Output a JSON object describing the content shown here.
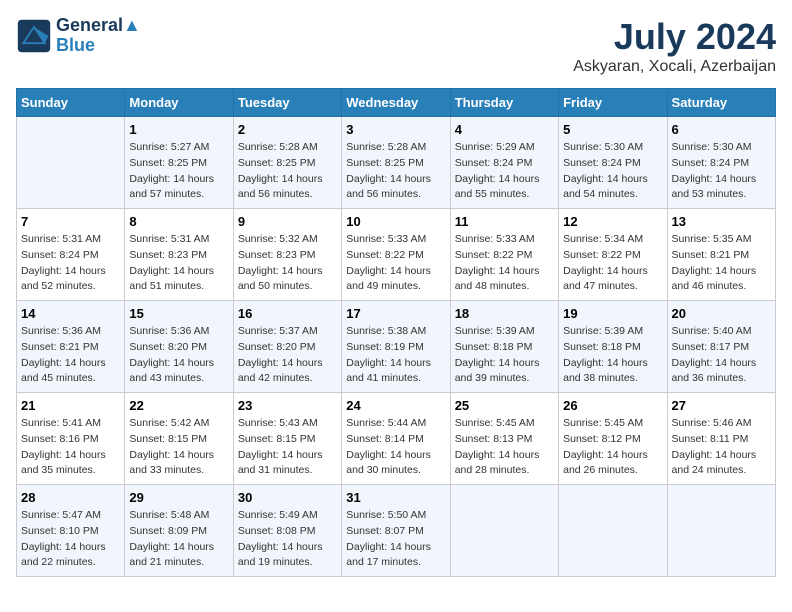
{
  "header": {
    "logo_line1": "General",
    "logo_line2": "Blue",
    "title": "July 2024",
    "subtitle": "Askyaran, Xocali, Azerbaijan"
  },
  "columns": [
    "Sunday",
    "Monday",
    "Tuesday",
    "Wednesday",
    "Thursday",
    "Friday",
    "Saturday"
  ],
  "weeks": [
    [
      {
        "day": "",
        "info": ""
      },
      {
        "day": "1",
        "info": "Sunrise: 5:27 AM\nSunset: 8:25 PM\nDaylight: 14 hours\nand 57 minutes."
      },
      {
        "day": "2",
        "info": "Sunrise: 5:28 AM\nSunset: 8:25 PM\nDaylight: 14 hours\nand 56 minutes."
      },
      {
        "day": "3",
        "info": "Sunrise: 5:28 AM\nSunset: 8:25 PM\nDaylight: 14 hours\nand 56 minutes."
      },
      {
        "day": "4",
        "info": "Sunrise: 5:29 AM\nSunset: 8:24 PM\nDaylight: 14 hours\nand 55 minutes."
      },
      {
        "day": "5",
        "info": "Sunrise: 5:30 AM\nSunset: 8:24 PM\nDaylight: 14 hours\nand 54 minutes."
      },
      {
        "day": "6",
        "info": "Sunrise: 5:30 AM\nSunset: 8:24 PM\nDaylight: 14 hours\nand 53 minutes."
      }
    ],
    [
      {
        "day": "7",
        "info": "Sunrise: 5:31 AM\nSunset: 8:24 PM\nDaylight: 14 hours\nand 52 minutes."
      },
      {
        "day": "8",
        "info": "Sunrise: 5:31 AM\nSunset: 8:23 PM\nDaylight: 14 hours\nand 51 minutes."
      },
      {
        "day": "9",
        "info": "Sunrise: 5:32 AM\nSunset: 8:23 PM\nDaylight: 14 hours\nand 50 minutes."
      },
      {
        "day": "10",
        "info": "Sunrise: 5:33 AM\nSunset: 8:22 PM\nDaylight: 14 hours\nand 49 minutes."
      },
      {
        "day": "11",
        "info": "Sunrise: 5:33 AM\nSunset: 8:22 PM\nDaylight: 14 hours\nand 48 minutes."
      },
      {
        "day": "12",
        "info": "Sunrise: 5:34 AM\nSunset: 8:22 PM\nDaylight: 14 hours\nand 47 minutes."
      },
      {
        "day": "13",
        "info": "Sunrise: 5:35 AM\nSunset: 8:21 PM\nDaylight: 14 hours\nand 46 minutes."
      }
    ],
    [
      {
        "day": "14",
        "info": "Sunrise: 5:36 AM\nSunset: 8:21 PM\nDaylight: 14 hours\nand 45 minutes."
      },
      {
        "day": "15",
        "info": "Sunrise: 5:36 AM\nSunset: 8:20 PM\nDaylight: 14 hours\nand 43 minutes."
      },
      {
        "day": "16",
        "info": "Sunrise: 5:37 AM\nSunset: 8:20 PM\nDaylight: 14 hours\nand 42 minutes."
      },
      {
        "day": "17",
        "info": "Sunrise: 5:38 AM\nSunset: 8:19 PM\nDaylight: 14 hours\nand 41 minutes."
      },
      {
        "day": "18",
        "info": "Sunrise: 5:39 AM\nSunset: 8:18 PM\nDaylight: 14 hours\nand 39 minutes."
      },
      {
        "day": "19",
        "info": "Sunrise: 5:39 AM\nSunset: 8:18 PM\nDaylight: 14 hours\nand 38 minutes."
      },
      {
        "day": "20",
        "info": "Sunrise: 5:40 AM\nSunset: 8:17 PM\nDaylight: 14 hours\nand 36 minutes."
      }
    ],
    [
      {
        "day": "21",
        "info": "Sunrise: 5:41 AM\nSunset: 8:16 PM\nDaylight: 14 hours\nand 35 minutes."
      },
      {
        "day": "22",
        "info": "Sunrise: 5:42 AM\nSunset: 8:15 PM\nDaylight: 14 hours\nand 33 minutes."
      },
      {
        "day": "23",
        "info": "Sunrise: 5:43 AM\nSunset: 8:15 PM\nDaylight: 14 hours\nand 31 minutes."
      },
      {
        "day": "24",
        "info": "Sunrise: 5:44 AM\nSunset: 8:14 PM\nDaylight: 14 hours\nand 30 minutes."
      },
      {
        "day": "25",
        "info": "Sunrise: 5:45 AM\nSunset: 8:13 PM\nDaylight: 14 hours\nand 28 minutes."
      },
      {
        "day": "26",
        "info": "Sunrise: 5:45 AM\nSunset: 8:12 PM\nDaylight: 14 hours\nand 26 minutes."
      },
      {
        "day": "27",
        "info": "Sunrise: 5:46 AM\nSunset: 8:11 PM\nDaylight: 14 hours\nand 24 minutes."
      }
    ],
    [
      {
        "day": "28",
        "info": "Sunrise: 5:47 AM\nSunset: 8:10 PM\nDaylight: 14 hours\nand 22 minutes."
      },
      {
        "day": "29",
        "info": "Sunrise: 5:48 AM\nSunset: 8:09 PM\nDaylight: 14 hours\nand 21 minutes."
      },
      {
        "day": "30",
        "info": "Sunrise: 5:49 AM\nSunset: 8:08 PM\nDaylight: 14 hours\nand 19 minutes."
      },
      {
        "day": "31",
        "info": "Sunrise: 5:50 AM\nSunset: 8:07 PM\nDaylight: 14 hours\nand 17 minutes."
      },
      {
        "day": "",
        "info": ""
      },
      {
        "day": "",
        "info": ""
      },
      {
        "day": "",
        "info": ""
      }
    ]
  ]
}
